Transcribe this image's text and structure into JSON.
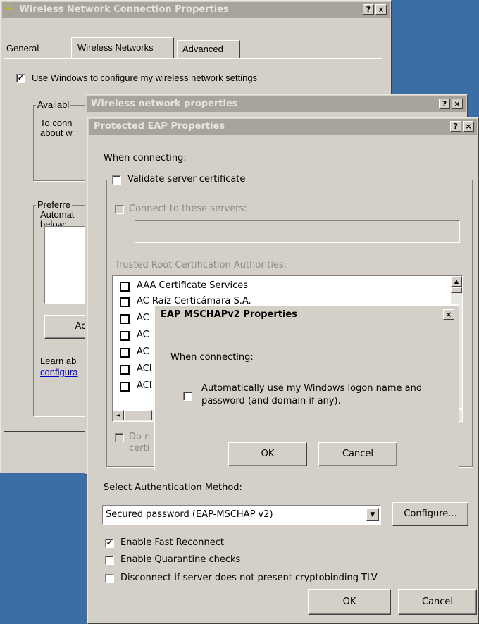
{
  "wireless_props": {
    "title": "Wireless Network Connection Properties",
    "tabs": [
      "General",
      "Wireless Networks",
      "Advanced"
    ],
    "use_windows_label": "Use Windows to configure my wireless network settings",
    "available_group": "Availabl",
    "available_text_1": "To conn",
    "available_text_2": "about w",
    "preferred_group": "Preferre",
    "preferred_text_1": "Automat",
    "preferred_text_2": "below:",
    "add_button": "Ad",
    "learn_text": "Learn ab",
    "learn_link": "configura",
    "help_btn": "?",
    "close_btn": "×"
  },
  "network_props": {
    "title": "Wireless network properties",
    "help_btn": "?",
    "close_btn": "×"
  },
  "peap": {
    "title": "Protected EAP Properties",
    "when_connecting": "When connecting:",
    "validate_cert": "Validate server certificate",
    "connect_servers": "Connect to these servers:",
    "trusted_root": "Trusted Root Certification Authorities:",
    "ca_list": [
      "AAA Certificate Services",
      "AC Raíz Certicámara S.A.",
      "AC",
      "AC",
      "AC",
      "ACI",
      "ACI"
    ],
    "do_not_prompt_1": "Do n",
    "do_not_prompt_2": "certi",
    "select_auth": "Select Authentication Method:",
    "auth_method": "Secured password (EAP-MSCHAP v2)",
    "configure_btn": "Configure...",
    "fast_reconnect": "Enable Fast Reconnect",
    "quarantine": "Enable Quarantine checks",
    "cryptobinding": "Disconnect if server does not present cryptobinding TLV",
    "ok_btn": "OK",
    "cancel_btn": "Cancel",
    "help_btn": "?",
    "close_btn": "×"
  },
  "mschap": {
    "title": "EAP MSCHAPv2 Properties",
    "when_connecting": "When connecting:",
    "auto_logon_1": "Automatically use my Windows logon name and",
    "auto_logon_2": "password (and domain if any).",
    "ok_btn": "OK",
    "cancel_btn": "Cancel",
    "close_btn": "×"
  },
  "checks": {
    "use_windows": "✓",
    "fast_reconnect": "✓"
  },
  "icons": {
    "network": "network-connection-icon",
    "scroll_up": "▲",
    "scroll_down": "▼",
    "scroll_left": "◄",
    "dropdown": "▼"
  }
}
